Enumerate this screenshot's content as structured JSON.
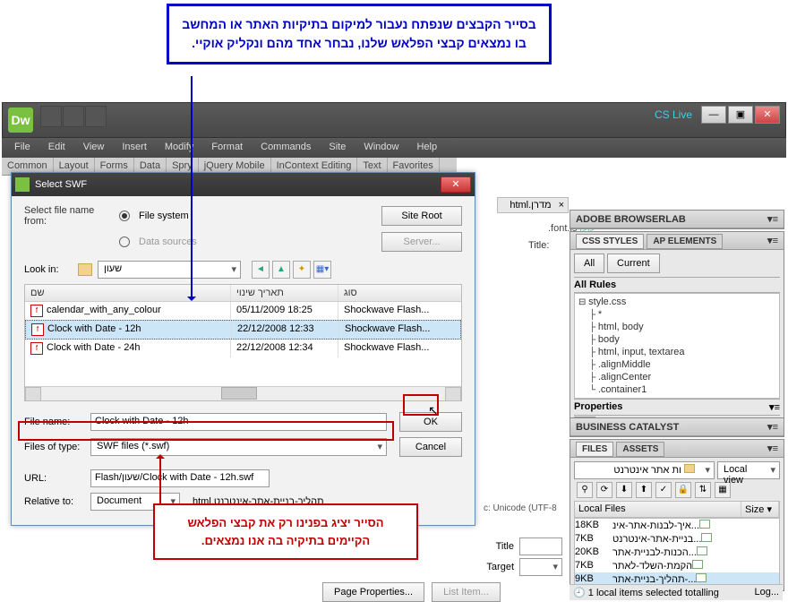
{
  "callouts": {
    "blue": "בסייר הקבצים שנפתח נעבור למיקום בתיקיות האתר או המחשב בו נמצאים קבצי הפלאש שלנו, נבחר אחד מהם ונקליק אוקיי.",
    "red": "הסייר יציג בפנינו רק את קבצי הפלאש הקיימים בתיקיה בה אנו נמצאים."
  },
  "menubar": [
    "File",
    "Edit",
    "View",
    "Insert",
    "Modify",
    "Format",
    "Commands",
    "Site",
    "Window",
    "Help"
  ],
  "insert_tabs": [
    "Common",
    "Layout",
    "Forms",
    "Data",
    "Spry",
    "jQuery Mobile",
    "InContext Editing",
    "Text",
    "Favorites"
  ],
  "cslive": "CS Live",
  "dialog": {
    "title": "Select SWF",
    "source_label": "Select file name from:",
    "radio_fs": "File system",
    "radio_ds": "Data sources",
    "btn_siteroot": "Site Root",
    "btn_server": "Server...",
    "lookin_label": "Look in:",
    "lookin_value": "שעון",
    "columns": {
      "name": "שם",
      "date": "תאריך שינוי",
      "type": "סוג"
    },
    "files": [
      {
        "name": "calendar_with_any_colour",
        "date": "05/11/2009 18:25",
        "type": "Shockwave Flash..."
      },
      {
        "name": "Clock with Date - 12h",
        "date": "22/12/2008 12:33",
        "type": "Shockwave Flash..."
      },
      {
        "name": "Clock with Date - 24h",
        "date": "22/12/2008 12:34",
        "type": "Shockwave Flash..."
      }
    ],
    "selected_index": 1,
    "filename_label": "File name:",
    "filename_value": "Clock with Date - 12h",
    "filetype_label": "Files of type:",
    "filetype_value": "SWF files (*.swf)",
    "ok": "OK",
    "cancel": "Cancel",
    "url_label": "URL:",
    "url_value": "Flash/שעון/Clock with Date - 12h.swf",
    "relative_label": "Relative to:",
    "relative_value": "Document",
    "relative_doc": "תהליך-בניית-אתר-אינטרנט.html"
  },
  "doc": {
    "tab_name": "מדרן.html",
    "tab_ext": "×",
    "script": ".font.js",
    "title_label": "Title:",
    "encoding": "c: Unicode (UTF-8"
  },
  "props": {
    "title_label": "Title",
    "target_label": "Target",
    "page_props": "Page Properties...",
    "list_item": "List Item..."
  },
  "panels": {
    "browserlab": "ADOBE BROWSERLAB",
    "css": {
      "tab1": "CSS STYLES",
      "tab2": "AP ELEMENTS",
      "all": "All",
      "current": "Current",
      "allrules": "All Rules",
      "root": "style.css",
      "rules": [
        "*",
        "html, body",
        "body",
        "html, input, textarea",
        ".alignMiddle",
        ".alignCenter",
        ".container1"
      ],
      "properties": "Properties"
    },
    "bc": "BUSINESS CATALYST",
    "files": {
      "tab1": "FILES",
      "tab2": "ASSETS",
      "site": "ות אתר אינטרנט",
      "view": "Local view",
      "localfiles": "Local Files",
      "size": "Size",
      "rows": [
        {
          "name": "...איך-לבנות-אתר-אינ",
          "size": "18KB"
        },
        {
          "name": "...בניית-אתר-אינטרנט",
          "size": "7KB"
        },
        {
          "name": "...הכנות-לבניית-אתר",
          "size": "20KB"
        },
        {
          "name": "הקמת-השלד-לאתר",
          "size": "7KB"
        },
        {
          "name": "...-תהליך-בניית-אתר",
          "size": "9KB"
        }
      ],
      "status_count": "1 local items selected totalling",
      "log": "Log..."
    }
  }
}
